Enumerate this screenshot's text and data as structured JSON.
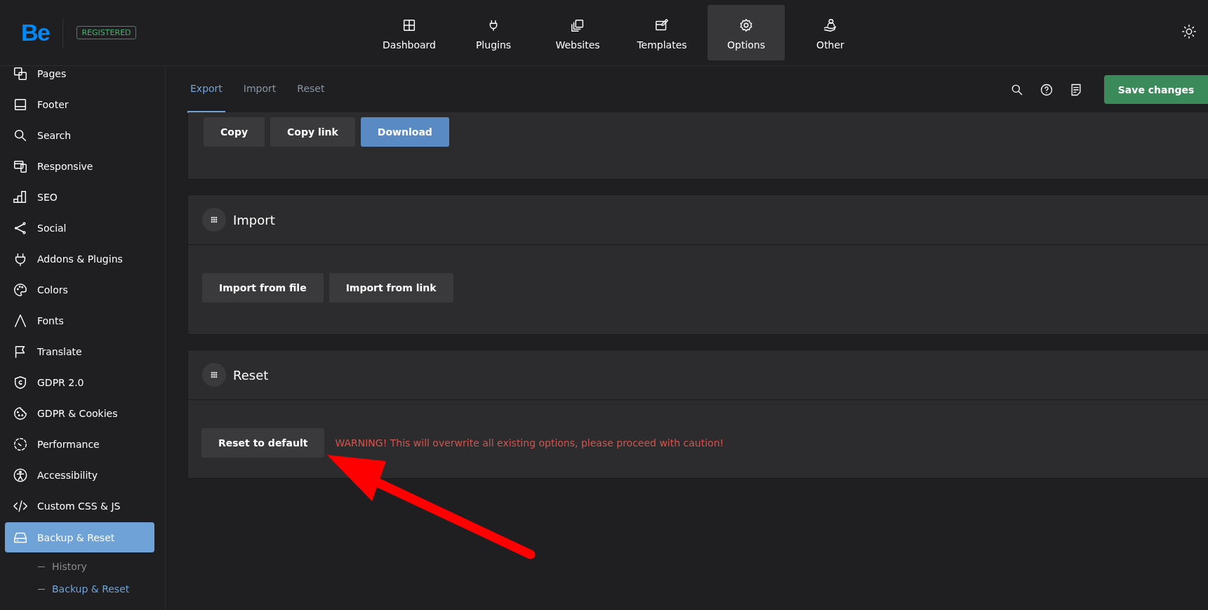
{
  "header": {
    "logo": "Be",
    "badge": "REGISTERED",
    "nav": [
      {
        "label": "Dashboard",
        "selected": false
      },
      {
        "label": "Plugins",
        "selected": false
      },
      {
        "label": "Websites",
        "selected": false
      },
      {
        "label": "Templates",
        "selected": false
      },
      {
        "label": "Options",
        "selected": true
      },
      {
        "label": "Other",
        "selected": false
      }
    ]
  },
  "sidebar": {
    "items": [
      {
        "label": "Pages",
        "selected": false
      },
      {
        "label": "Footer",
        "selected": false
      },
      {
        "label": "Search",
        "selected": false
      },
      {
        "label": "Responsive",
        "selected": false
      },
      {
        "label": "SEO",
        "selected": false
      },
      {
        "label": "Social",
        "selected": false
      },
      {
        "label": "Addons & Plugins",
        "selected": false
      },
      {
        "label": "Colors",
        "selected": false
      },
      {
        "label": "Fonts",
        "selected": false
      },
      {
        "label": "Translate",
        "selected": false
      },
      {
        "label": "GDPR 2.0",
        "selected": false
      },
      {
        "label": "GDPR & Cookies",
        "selected": false
      },
      {
        "label": "Performance",
        "selected": false
      },
      {
        "label": "Accessibility",
        "selected": false
      },
      {
        "label": "Custom CSS & JS",
        "selected": false
      },
      {
        "label": "Backup & Reset",
        "selected": true,
        "expanded": true,
        "children": [
          {
            "label": "History",
            "selected": false
          },
          {
            "label": "Backup & Reset",
            "selected": true
          }
        ]
      }
    ]
  },
  "tabs": [
    {
      "label": "Export",
      "selected": true
    },
    {
      "label": "Import",
      "selected": false
    },
    {
      "label": "Reset",
      "selected": false
    }
  ],
  "save_button": "Save changes",
  "sections": [
    {
      "buttons": [
        {
          "label": "Copy",
          "primary": false
        },
        {
          "label": "Copy link",
          "primary": false
        },
        {
          "label": "Download",
          "primary": true
        }
      ]
    },
    {
      "title": "Import",
      "buttons": [
        {
          "label": "Import from file",
          "primary": false
        },
        {
          "label": "Import from link",
          "primary": false
        }
      ]
    },
    {
      "title": "Reset",
      "buttons": [
        {
          "label": "Reset to default",
          "primary": false
        }
      ],
      "warning": "WARNING! This will overwrite all existing options, please proceed with caution!"
    }
  ]
}
